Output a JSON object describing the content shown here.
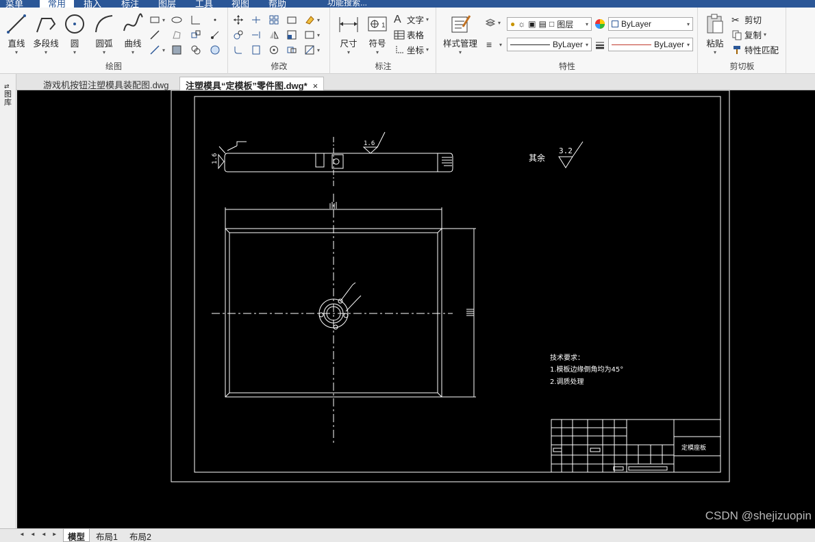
{
  "menu": {
    "tabs": [
      {
        "label": "菜单"
      },
      {
        "label": "常用"
      },
      {
        "label": "插入"
      },
      {
        "label": "标注"
      },
      {
        "label": "图层"
      },
      {
        "label": "工具"
      },
      {
        "label": "视图"
      },
      {
        "label": "帮助"
      },
      {
        "label": "功能搜索..."
      }
    ]
  },
  "ribbon": {
    "draw": {
      "title": "绘图",
      "line": "直线",
      "polyline": "多段线",
      "circle": "圆",
      "arc": "圆弧",
      "curve": "曲线"
    },
    "modify": {
      "title": "修改"
    },
    "annotate": {
      "title": "标注",
      "dimension": "尺寸",
      "symbol": "符号",
      "text": "文字",
      "table": "表格",
      "coordinate": "坐标"
    },
    "properties": {
      "title": "特性",
      "style_manager": "样式管理",
      "layer_label": "图层",
      "color_value": "ByLayer",
      "linetype_value": "ByLayer",
      "lineweight_value": "ByLayer"
    },
    "clipboard": {
      "title": "剪切板",
      "paste": "粘贴",
      "cut": "剪切",
      "copy": "复制",
      "match_props": "特性匹配"
    }
  },
  "doc_tabs": [
    {
      "label": "游戏机按钮注塑模具装配图.dwg"
    },
    {
      "label": "注塑模具“定模板”零件图.dwg*"
    }
  ],
  "close_glyph": "×",
  "left_dock": {
    "label": "图库"
  },
  "drawing": {
    "roughness_top": "1.6",
    "roughness_left": "1.6",
    "roughness_other": "3.2",
    "other_label": "其余",
    "tech_title": "技术要求：",
    "tech_items": [
      "1.模板边缘倒角均为45°",
      "2.调质处理"
    ],
    "title_block_name": "定模座板"
  },
  "layout_tabs": [
    {
      "label": "模型"
    },
    {
      "label": "布局1"
    },
    {
      "label": "布局2"
    }
  ],
  "layout_nav": "◄◄◄►►",
  "watermark": "CSDN @shejizuopin",
  "colors": {
    "accent": "#2b5797",
    "canvas": "#000000",
    "cad_line": "#ffffff",
    "linetype_red": "#c0392b"
  }
}
